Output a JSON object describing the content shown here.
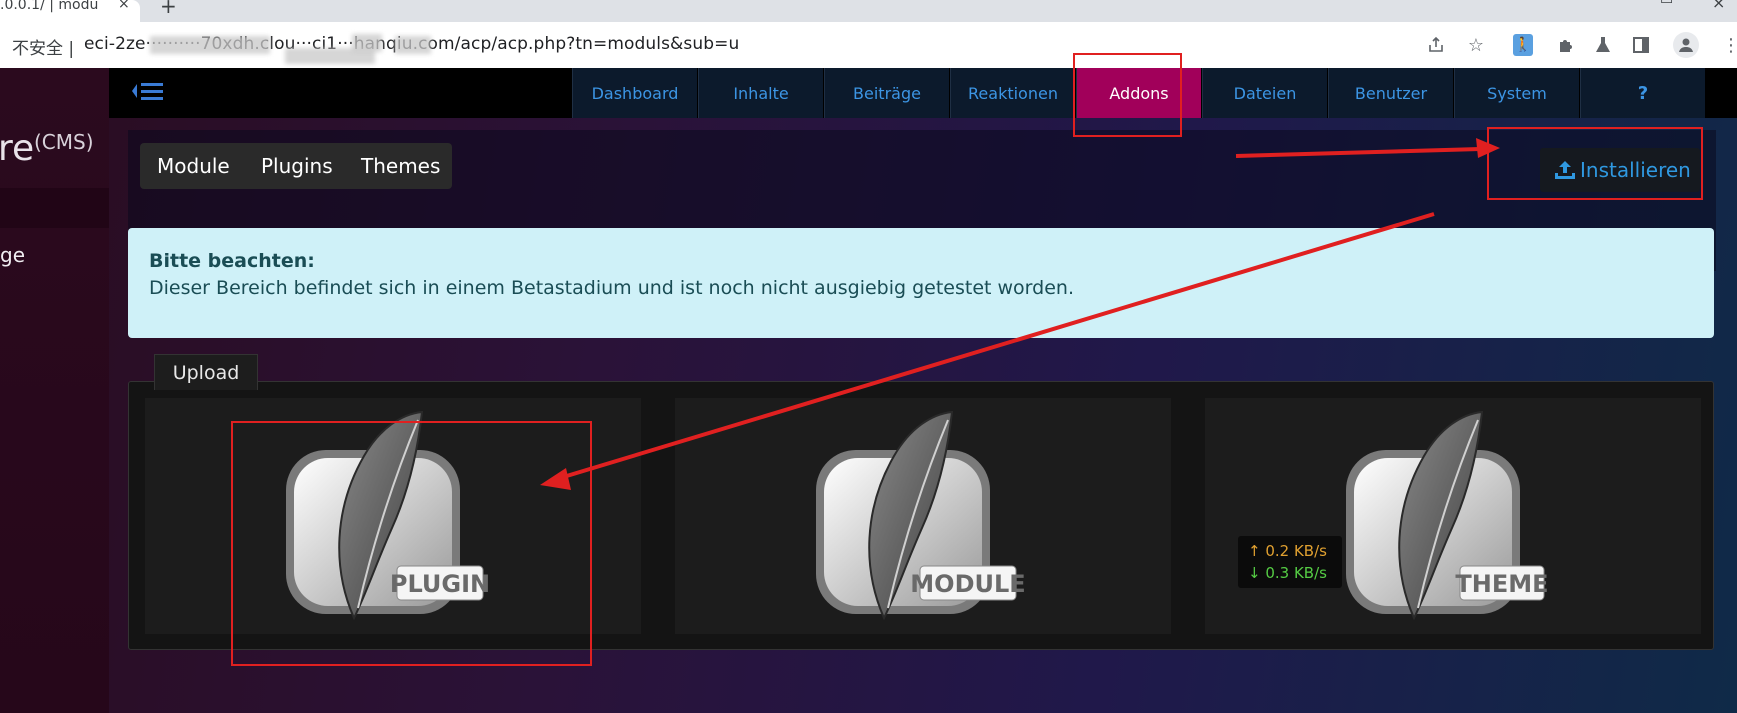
{
  "browser": {
    "tab_title": ".0.0.1/ | modu",
    "tab_close": "×",
    "new_tab": "+",
    "insecure_label": "不安全 |",
    "url": "eci-2ze··········70xdh.clou···ci1···hanqiu.com/acp/acp.php?tn=moduls&sub=u"
  },
  "sidebar": {
    "brand_text": "re",
    "brand_suffix": "(CMS)",
    "item_label": "ge"
  },
  "nav": {
    "items": [
      {
        "label": "Dashboard"
      },
      {
        "label": "Inhalte"
      },
      {
        "label": "Beiträge"
      },
      {
        "label": "Reaktionen"
      },
      {
        "label": "Addons",
        "active": true
      },
      {
        "label": "Dateien"
      },
      {
        "label": "Benutzer"
      },
      {
        "label": "System"
      },
      {
        "label": "?"
      }
    ]
  },
  "subnav": {
    "tabs": [
      {
        "label": "Module"
      },
      {
        "label": "Plugins"
      },
      {
        "label": "Themes"
      }
    ],
    "install_label": "Installieren"
  },
  "alert": {
    "title": "Bitte beachten:",
    "text": "Dieser Bereich befindet sich in einem Betastadium und ist noch nicht ausgiebig getestet worden."
  },
  "upload": {
    "tab_label": "Upload",
    "cards": [
      {
        "label": "PLUGIN"
      },
      {
        "label": "MODULE"
      },
      {
        "label": "THEME"
      }
    ]
  },
  "speed_widget": {
    "up": "↑ 0.2 KB/s",
    "down": "↓ 0.3 KB/s"
  },
  "colors": {
    "accent_active": "#a1005a",
    "nav_link": "#3c95e4",
    "annotation_red": "#e02020"
  }
}
